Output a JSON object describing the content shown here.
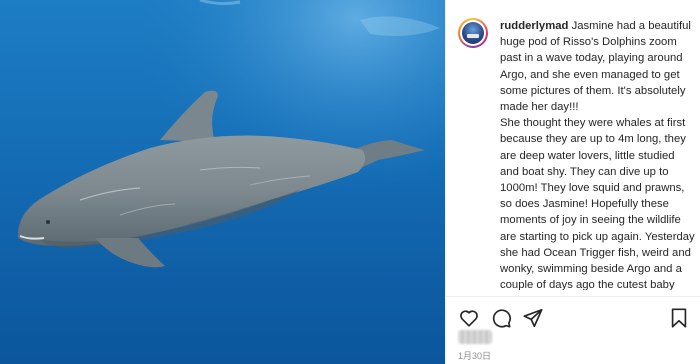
{
  "post": {
    "username": "rudderlymad",
    "caption_intro": "Jasmine had a beautiful huge pod of Risso's Dolphins zoom past in a wave today, playing around Argo, and she even managed to get some pictures of them. It's absolutely made her day!!!",
    "caption_body": "She thought they were whales at first because they are up to 4m long, they are deep water lovers, little studied and boat shy. They can dive up to 1000m! They love squid and prawns, so does Jasmine! Hopefully these moments of joy in seeing the wildlife are starting to pick up again. Yesterday she had Ocean Trigger fish, weird and wonky, swimming beside Argo and a couple of days ago the cutest baby turtle swam past East to West with its snout up and flippers",
    "date": "1月30日"
  },
  "icons": {
    "like": "heart-icon",
    "comment": "comment-icon",
    "share": "share-icon",
    "save": "bookmark-icon"
  }
}
